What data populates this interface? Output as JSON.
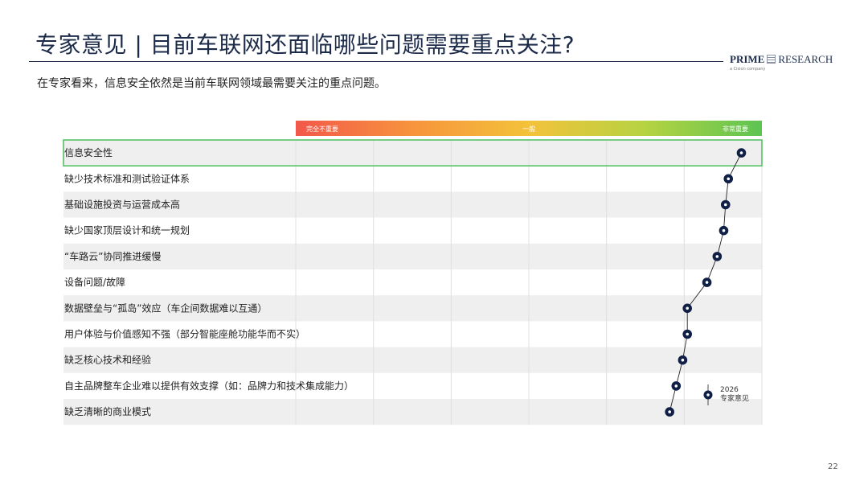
{
  "header": {
    "title": "专家意见 | 目前车联网还面临哪些问题需要重点关注?",
    "subtitle": "在专家看来，信息安全依然是当前车联网领域最需要关注的重点问题。",
    "logo": {
      "word1": "PRIME",
      "word2": "RESEARCH",
      "tagline": "a Cision company"
    },
    "page_number": "22"
  },
  "colors": {
    "dark_navy": "#1c2b4a",
    "highlight_border": "#4cbf5a",
    "row_shade": "#efefef",
    "marker": "#0f1f45"
  },
  "chart_data": {
    "type": "scatter",
    "scale_labels": {
      "low": "完全不重要",
      "mid": "一般",
      "high": "非常重要"
    },
    "categories": [
      "信息安全性",
      "缺少技术标准和测试验证体系",
      "基础设施投资与运营成本高",
      "缺少国家顶层设计和统一规划",
      "“车路云”协同推进缓慢",
      "设备问题/故障",
      "数据壁垒与“孤岛”效应（车企间数据难以互通）",
      "用户体验与价值感知不强（部分智能座舱功能华而不实）",
      "缺乏核心技术和经验",
      "自主品牌整车企业难以提供有效支撑（如：品牌力和技术集成能力）",
      "缺乏清晰的商业模式"
    ],
    "series": [
      {
        "name": "2026 专家意见",
        "values": [
          5.78,
          5.64,
          5.61,
          5.59,
          5.52,
          5.41,
          5.2,
          5.2,
          5.15,
          5.08,
          5.01
        ]
      }
    ],
    "xlim": [
      1,
      6
    ],
    "highlighted_category": "信息安全性",
    "legend": {
      "year": "2026",
      "label": "专家意见",
      "placement": "bottom-right"
    }
  }
}
